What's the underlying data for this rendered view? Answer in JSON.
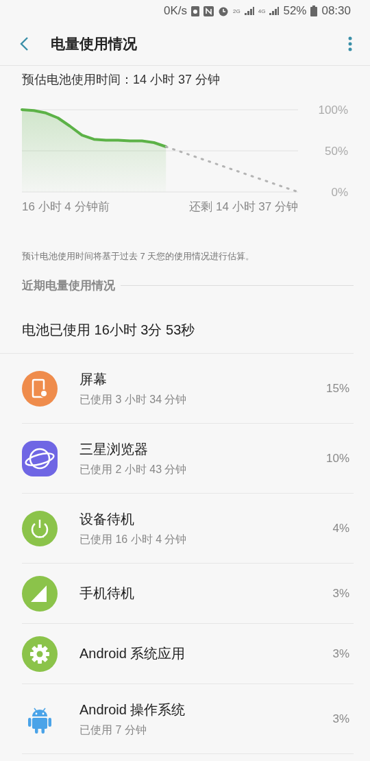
{
  "status_bar": {
    "speed": "0K/s",
    "network_2g": "2G",
    "network_4g": "4G",
    "battery": "52%",
    "time": "08:30"
  },
  "app_bar": {
    "title": "电量使用情况"
  },
  "estimate": {
    "text": "预估电池使用时间：14 小时 37 分钟",
    "chart_data": {
      "type": "line",
      "ylim": [
        0,
        100
      ],
      "yticks": [
        {
          "value": 0,
          "label": "0%"
        },
        {
          "value": 50,
          "label": "50%"
        },
        {
          "value": 100,
          "label": "100%"
        }
      ],
      "series": [
        {
          "color": "#5cb247",
          "values": [
            100,
            99,
            96,
            90,
            80,
            69,
            64,
            63,
            63,
            62,
            62,
            60,
            55,
            null,
            null,
            null,
            null,
            null,
            null,
            null,
            null,
            null,
            null,
            null
          ]
        },
        {
          "color": "#b4b4b4",
          "line_style": "dotted",
          "values": [
            null,
            null,
            null,
            null,
            null,
            null,
            null,
            null,
            null,
            null,
            null,
            null,
            55,
            50,
            45,
            40,
            35,
            30,
            25,
            20,
            15,
            10,
            5,
            0
          ]
        }
      ]
    },
    "start_label": "16 小时 4 分钟前",
    "end_label": "还剩 14 小时 37 分钟",
    "note": "预计电池使用时间将基于过去 7 天您的使用情况进行估算。"
  },
  "recent": {
    "header": "近期电量使用情况",
    "total": "电池已使用 16小时 3分 53秒",
    "items": [
      {
        "name": "屏幕",
        "usage": "已使用 3 小时 34 分钟",
        "percent": "15%"
      },
      {
        "name": "三星浏览器",
        "usage": "已使用 2 小时 43 分钟",
        "percent": "10%"
      },
      {
        "name": "设备待机",
        "usage": "已使用 16 小时 4 分钟",
        "percent": "4%"
      },
      {
        "name": "手机待机",
        "percent": "3%"
      },
      {
        "name": "Android 系统应用",
        "percent": "3%"
      },
      {
        "name": "Android 操作系统",
        "usage": "已使用 7 分钟",
        "percent": "3%"
      }
    ]
  }
}
